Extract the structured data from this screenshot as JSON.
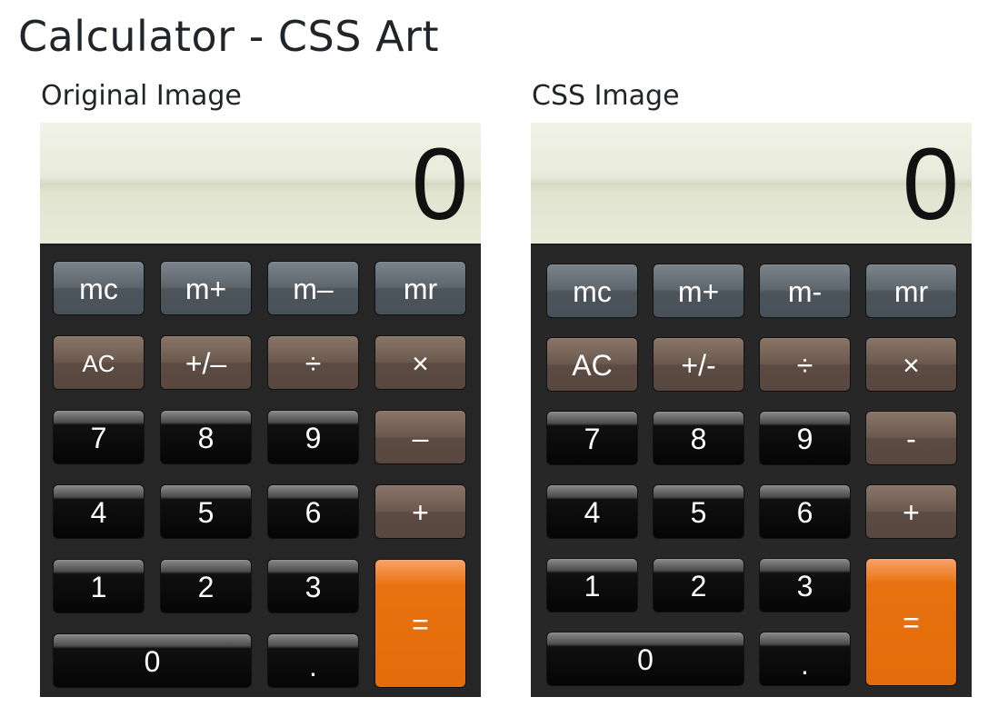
{
  "page": {
    "title": "Calculator - CSS Art",
    "original_heading": "Original Image",
    "css_heading": "CSS Image"
  },
  "original": {
    "display": "0",
    "keys": {
      "mc": "mc",
      "mplus": "m+",
      "mminus": "m–",
      "mr": "mr",
      "ac": "AC",
      "sign": "+/–",
      "divide": "÷",
      "multiply": "×",
      "k7": "7",
      "k8": "8",
      "k9": "9",
      "minus": "–",
      "k4": "4",
      "k5": "5",
      "k6": "6",
      "plus": "+",
      "k1": "1",
      "k2": "2",
      "k3": "3",
      "equals": "=",
      "k0": "0",
      "dot": "."
    }
  },
  "css": {
    "display": "0",
    "keys": {
      "mc": "mc",
      "mplus": "m+",
      "mminus": "m-",
      "mr": "mr",
      "ac": "AC",
      "sign": "+/-",
      "divide": "÷",
      "multiply": "×",
      "k7": "7",
      "k8": "8",
      "k9": "9",
      "minus": "-",
      "k4": "4",
      "k5": "5",
      "k6": "6",
      "plus": "+",
      "k1": "1",
      "k2": "2",
      "k3": "3",
      "equals": "=",
      "k0": "0",
      "dot": "."
    }
  },
  "colors": {
    "memory_key": "#555d63",
    "operator_key": "#635148",
    "number_key": "#050505",
    "equals_key": "#e46c0a",
    "display_bg": "#e5e7d6",
    "body_bg": "#262626"
  }
}
